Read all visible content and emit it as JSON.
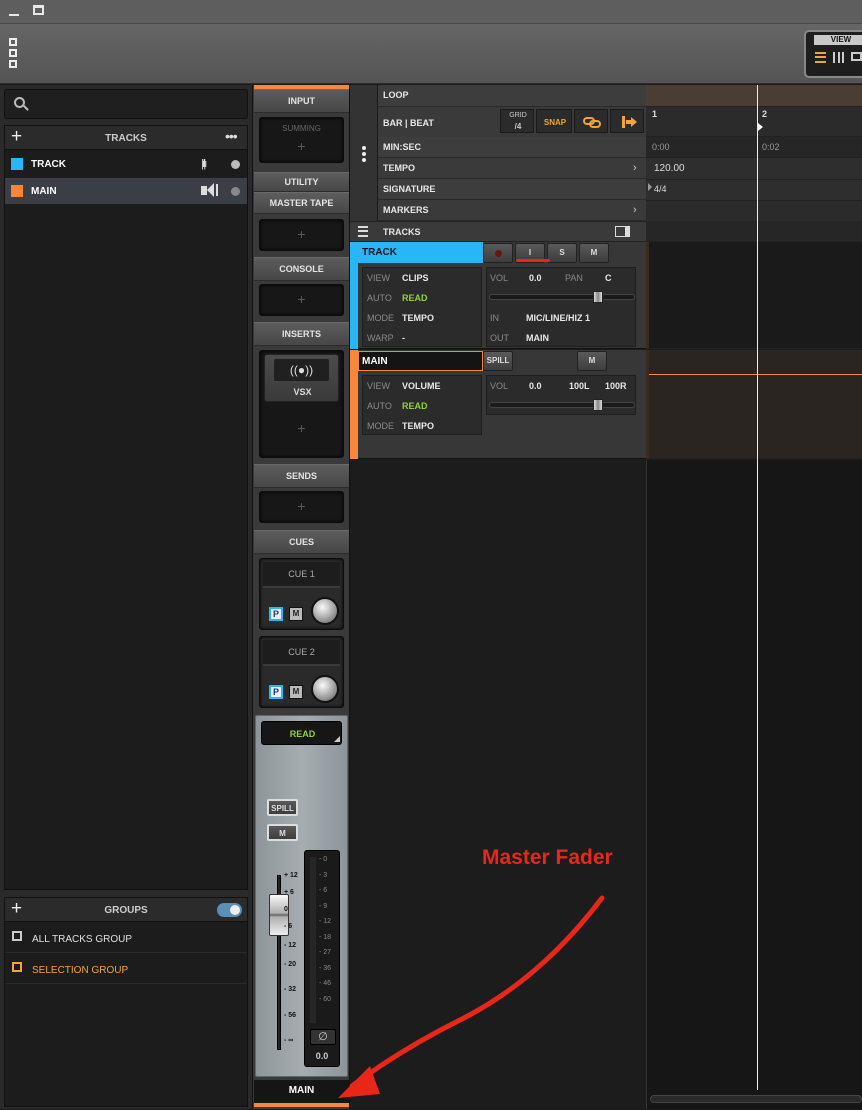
{
  "window": {
    "minimize_glyph": "▁",
    "maximize_glyph": "□"
  },
  "view_panel": {
    "label": "VIEW"
  },
  "left_panel": {
    "search_placeholder": "",
    "tracks_header": "TRACKS",
    "tracks": [
      {
        "name": "TRACK",
        "color": "#29b6f6"
      },
      {
        "name": "MAIN",
        "color": "#f7873a"
      }
    ],
    "groups_header": "GROUPS",
    "groups": [
      {
        "name": "ALL TRACKS GROUP",
        "color": "#e0e0e0"
      },
      {
        "name": "SELECTION GROUP",
        "color": "#f2a33a"
      }
    ]
  },
  "channel_strip": {
    "input": "INPUT",
    "summing": "SUMMING",
    "utility": "UTILITY",
    "master_tape": "MASTER TAPE",
    "console": "CONSOLE",
    "inserts": "INSERTS",
    "insert_plugin": "VSX",
    "sends": "SENDS",
    "cues": "CUES",
    "cue1": "CUE 1",
    "cue2": "CUE 2",
    "cue_p": "P",
    "cue_m": "M",
    "automation": "READ",
    "spill": "SPILL",
    "mute": "M",
    "fader_scale": [
      "12",
      "6",
      "0",
      "6",
      "12",
      "20",
      "32",
      "56",
      "∞"
    ],
    "fader_signs": [
      "+",
      "+",
      "",
      "-",
      "-",
      "-",
      "-",
      "-",
      "-"
    ],
    "meter_scale": [
      "0",
      "3",
      "6",
      "9",
      "12",
      "18",
      "27",
      "36",
      "46",
      "60"
    ],
    "phase": "∅",
    "level": "0.0",
    "name": "MAIN"
  },
  "timeline": {
    "rows": [
      {
        "label": "LOOP"
      },
      {
        "label": "BAR | BEAT"
      },
      {
        "label": "MIN:SEC"
      },
      {
        "label": "TEMPO",
        "value": "120.00"
      },
      {
        "label": "SIGNATURE",
        "value": "4/4"
      },
      {
        "label": "MARKERS"
      }
    ],
    "grid_label": "GRID",
    "grid_value": "/4",
    "snap_label": "SNAP",
    "bar_numbers": [
      "1",
      "2"
    ],
    "time_marks": [
      "0:00",
      "0:02"
    ],
    "tracks_label": "TRACKS"
  },
  "track_headers": [
    {
      "name": "TRACK",
      "color": "#29b6f6",
      "buttons": [
        "●",
        "I",
        "S",
        "M"
      ],
      "view_label": "VIEW",
      "view": "CLIPS",
      "auto_label": "AUTO",
      "auto": "READ",
      "mode_label": "MODE",
      "mode": "TEMPO",
      "warp_label": "WARP",
      "warp": "-",
      "vol_label": "VOL",
      "vol": "0.0",
      "pan_label": "PAN",
      "pan": "C",
      "in_label": "IN",
      "in": "MIC/LINE/HIZ 1",
      "out_label": "OUT",
      "out": "MAIN"
    },
    {
      "name": "MAIN",
      "color": "#f7873a",
      "spill": "SPILL",
      "mute": "M",
      "view_label": "VIEW",
      "view": "VOLUME",
      "auto_label": "AUTO",
      "auto": "READ",
      "mode_label": "MODE",
      "mode": "TEMPO",
      "vol_label": "VOL",
      "vol": "0.0",
      "pan_l": "100L",
      "pan_r": "100R"
    }
  ],
  "annotation": {
    "text": "Master Fader",
    "color": "#e8261a"
  }
}
